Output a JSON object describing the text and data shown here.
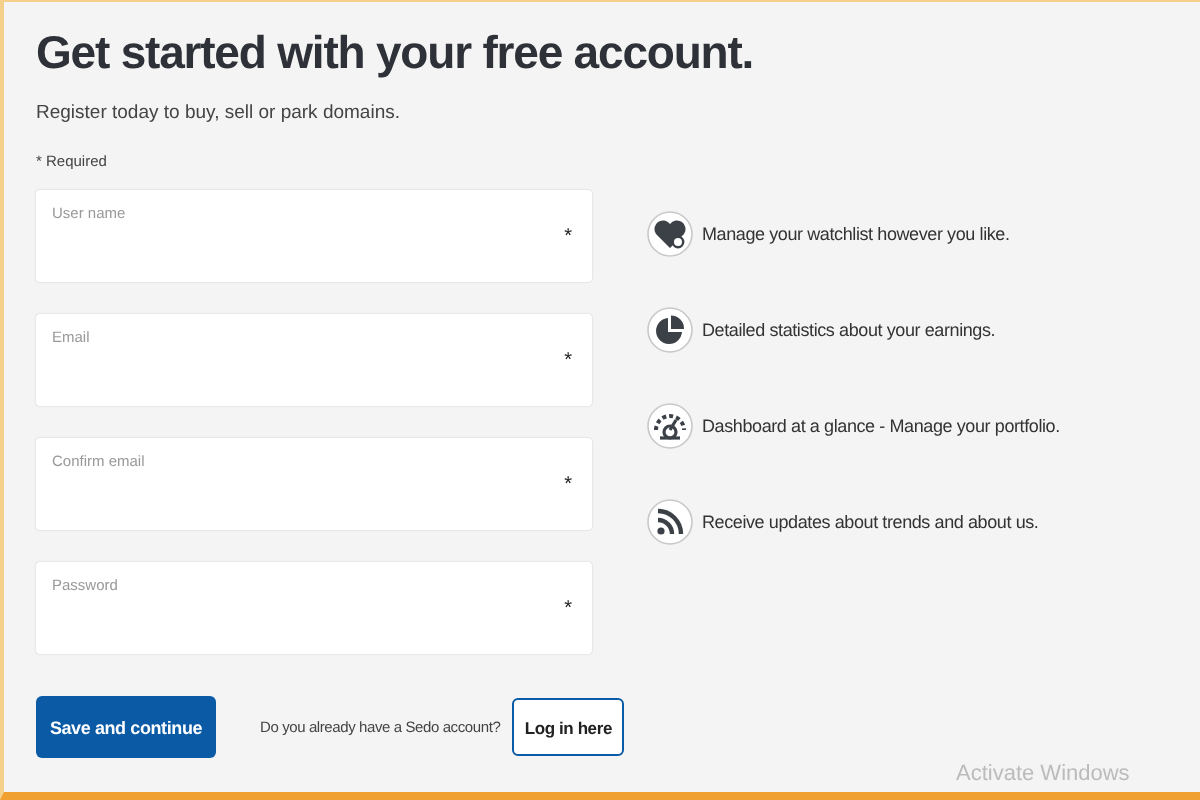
{
  "heading": "Get started with your free account.",
  "subtitle": "Register today to buy, sell or park domains.",
  "required_note": "* Required",
  "fields": [
    {
      "label": "User name",
      "required_mark": "*"
    },
    {
      "label": "Email",
      "required_mark": "*"
    },
    {
      "label": "Confirm email",
      "required_mark": "*"
    },
    {
      "label": "Password",
      "required_mark": "*"
    }
  ],
  "features": [
    {
      "kind": "watchlist",
      "text": "Manage your watchlist however you like."
    },
    {
      "kind": "statistics",
      "text": "Detailed statistics about your earnings."
    },
    {
      "kind": "dashboard",
      "text": "Dashboard at a glance - Manage your portfolio."
    },
    {
      "kind": "rss",
      "text": "Receive updates about trends and about us."
    }
  ],
  "save_button": "Save and continue",
  "login_prompt": "Do you already have a Sedo account?",
  "login_button": "Log in here",
  "os_notice": "Activate Windows"
}
